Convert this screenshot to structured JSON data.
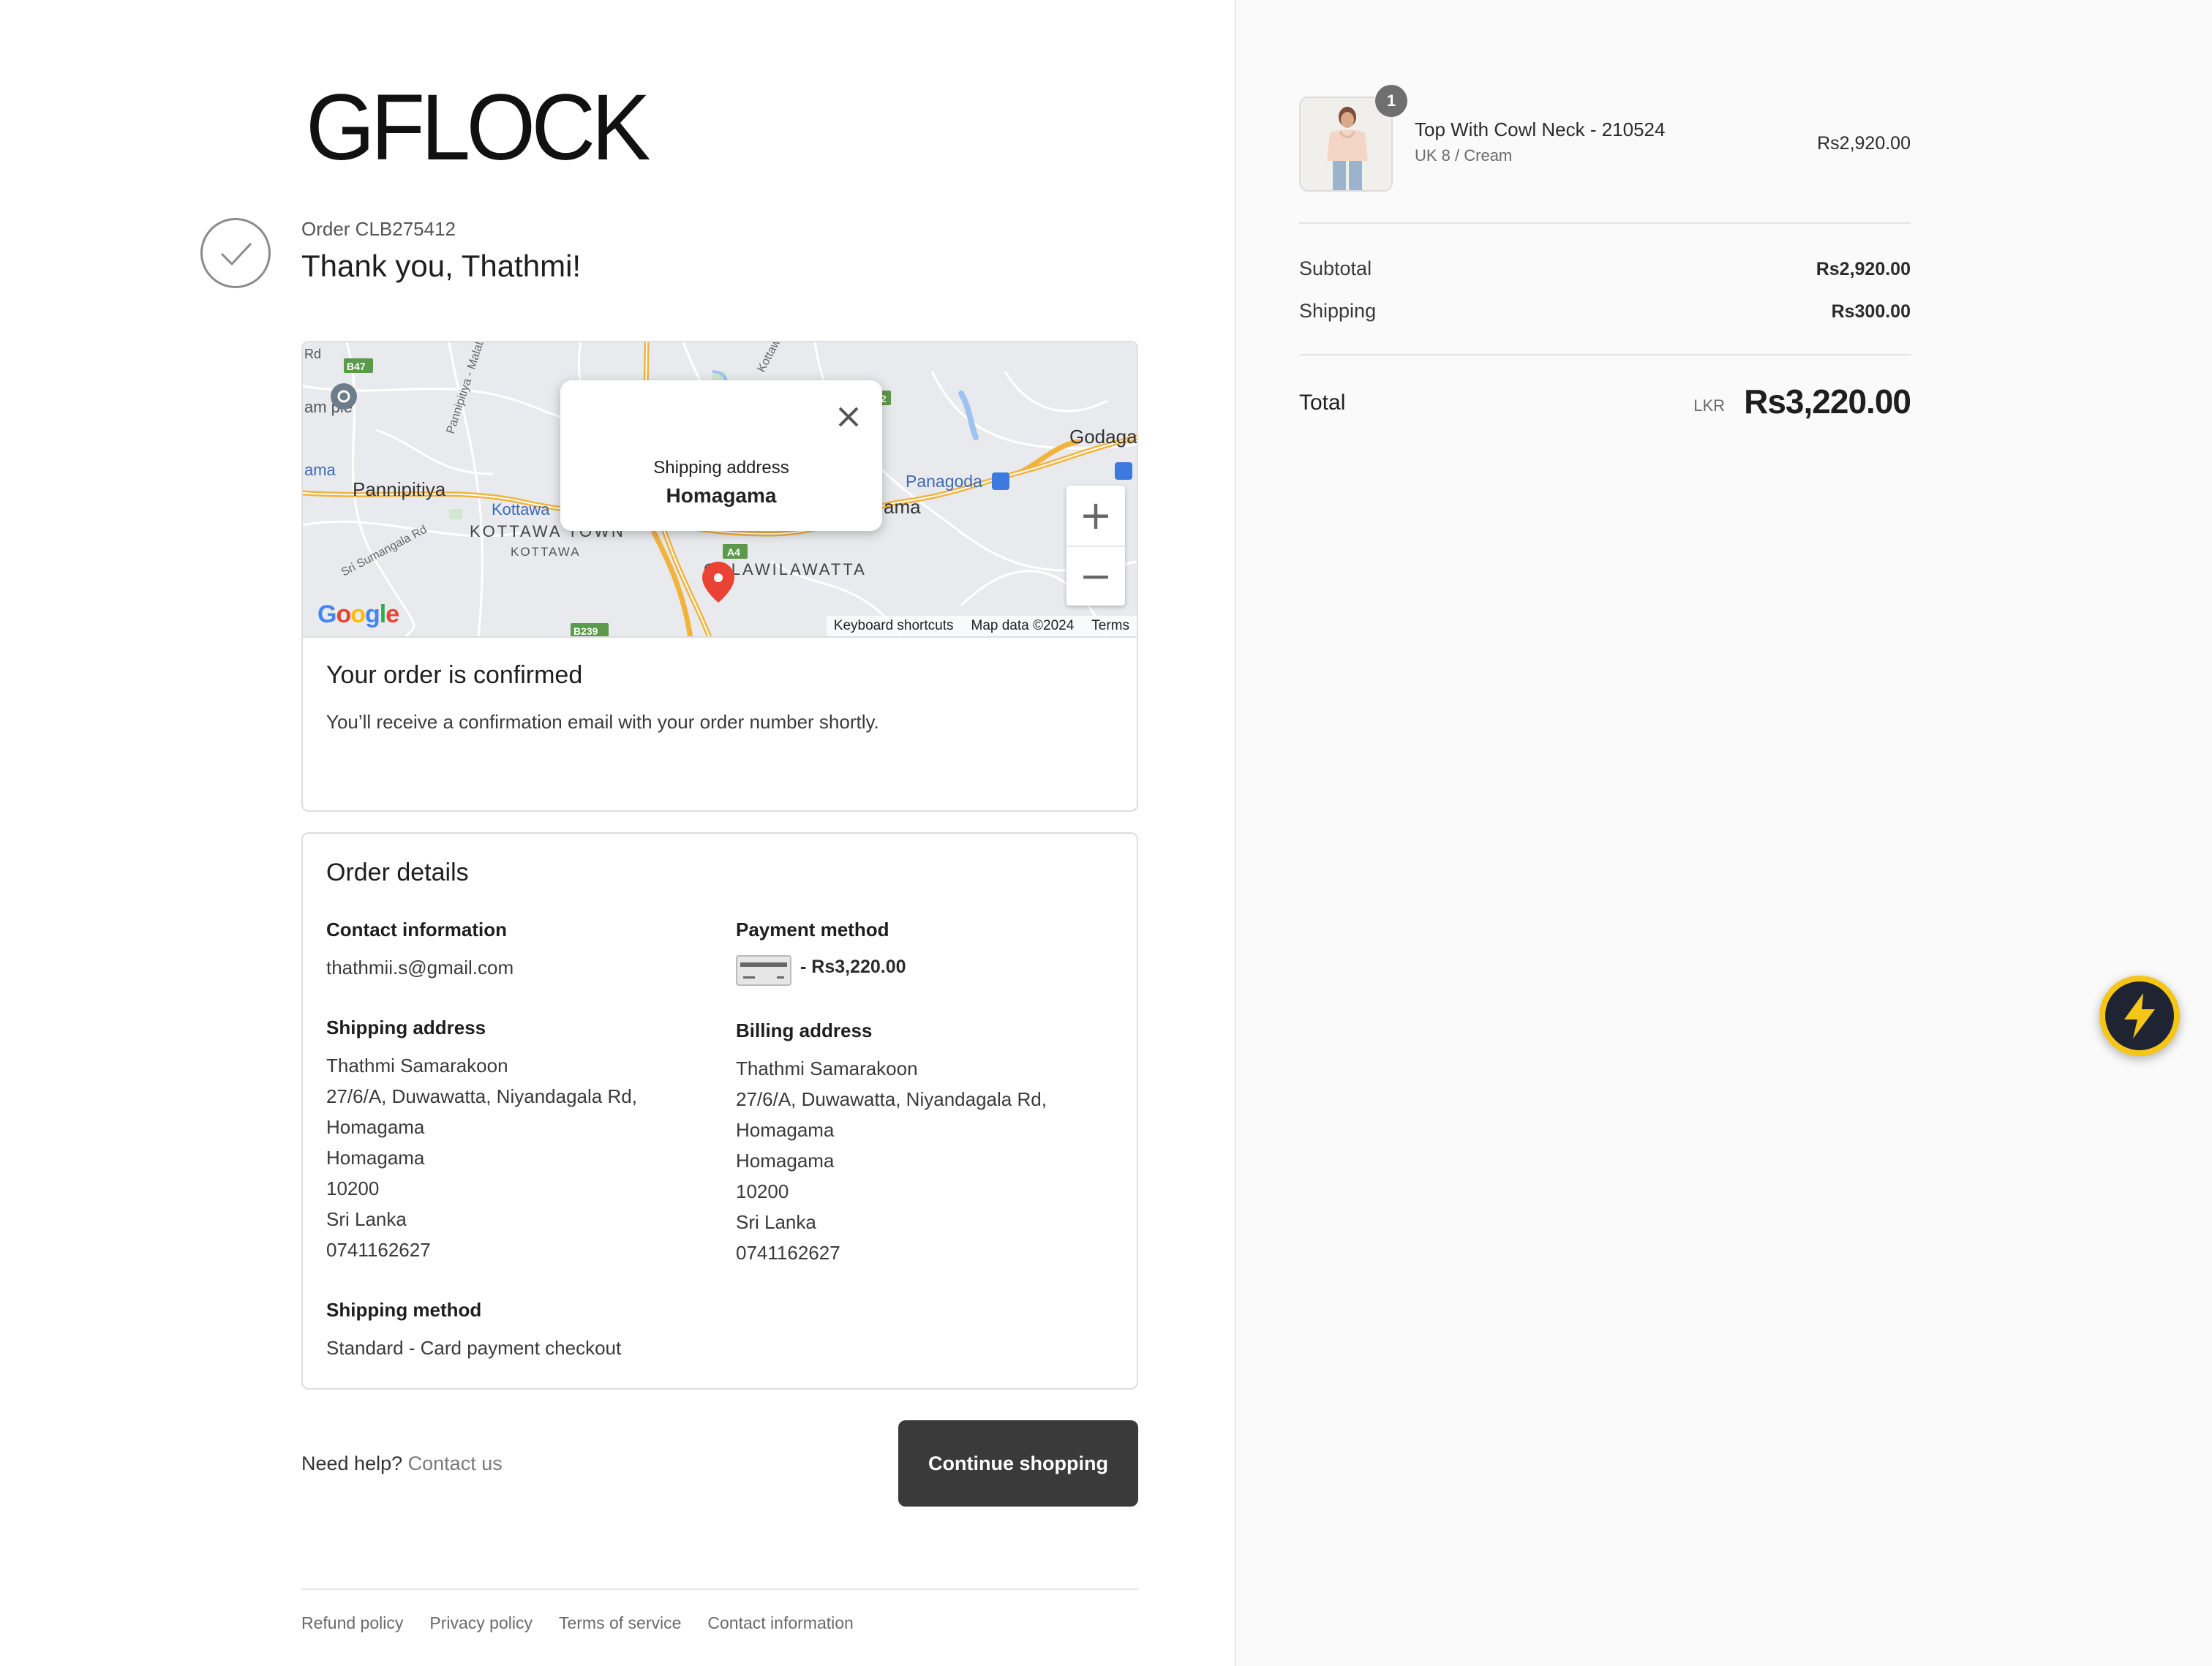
{
  "brand": {
    "logo_text": "GFLOCK"
  },
  "order": {
    "number_label": "Order CLB275412",
    "thank_you": "Thank you, Thathmi!"
  },
  "map": {
    "popup_label": "Shipping address",
    "popup_value": "Homagama",
    "places": {
      "pannipitiya": "Pannipitiya",
      "kottawa": "Kottawa",
      "kottawa_town": "KOTTAWA TOWN",
      "kottawa_small": "KOTTAWA",
      "godagama": "Godaga",
      "panagoda": "Panagoda",
      "galawilawatta": "GALAWILAWATTA",
      "homagama_partial": "ama",
      "ama_left": "ama",
      "malabe_rd": "Pannipitiya - Malabe R",
      "sumangala_rd": "Sri Sumangala Rd",
      "kottawa_road": "Kottaw",
      "rd": "Rd",
      "temple": "am ple"
    },
    "road_badges": [
      "B47",
      "A4",
      "B239",
      "2"
    ],
    "footer": {
      "shortcuts": "Keyboard shortcuts",
      "data": "Map data ©2024",
      "terms": "Terms"
    },
    "google": "Google"
  },
  "confirm": {
    "title": "Your order is confirmed",
    "text": "You’ll receive a confirmation email with your order number shortly."
  },
  "details": {
    "title": "Order details",
    "contact": {
      "label": "Contact information",
      "value": "thathmii.s@gmail.com"
    },
    "payment": {
      "label": "Payment method",
      "value": "- Rs3,220.00"
    },
    "shipping_address": {
      "label": "Shipping address",
      "lines": [
        "Thathmi Samarakoon",
        "27/6/A, Duwawatta, Niyandagala Rd,",
        "Homagama",
        "Homagama",
        "10200",
        "Sri Lanka",
        "0741162627"
      ]
    },
    "billing_address": {
      "label": "Billing address",
      "lines": [
        "Thathmi Samarakoon",
        "27/6/A, Duwawatta, Niyandagala Rd,",
        "Homagama",
        "Homagama",
        "10200",
        "Sri Lanka",
        "0741162627"
      ]
    },
    "shipping_method": {
      "label": "Shipping method",
      "value": "Standard - Card payment checkout"
    }
  },
  "help": {
    "prefix": "Need help?",
    "link": "Contact us"
  },
  "continue_label": "Continue shopping",
  "footer_links": [
    "Refund policy",
    "Privacy policy",
    "Terms of service",
    "Contact information"
  ],
  "summary": {
    "product": {
      "name": "Top With Cowl Neck - 210524",
      "variant": "UK 8 / Cream",
      "price": "Rs2,920.00",
      "quantity": "1"
    },
    "subtotal_label": "Subtotal",
    "subtotal_value": "Rs2,920.00",
    "shipping_label": "Shipping",
    "shipping_value": "Rs300.00",
    "total_label": "Total",
    "total_currency": "LKR",
    "total_value": "Rs3,220.00"
  },
  "colors": {
    "accent_button": "#3a3a3a",
    "bolt_ring": "#f5c518",
    "map_pin": "#ea4335"
  },
  "icons": [
    "check-icon",
    "close-icon",
    "zoom-in-icon",
    "zoom-out-icon",
    "map-pin-icon",
    "credit-card-icon",
    "lightning-bolt-icon"
  ]
}
